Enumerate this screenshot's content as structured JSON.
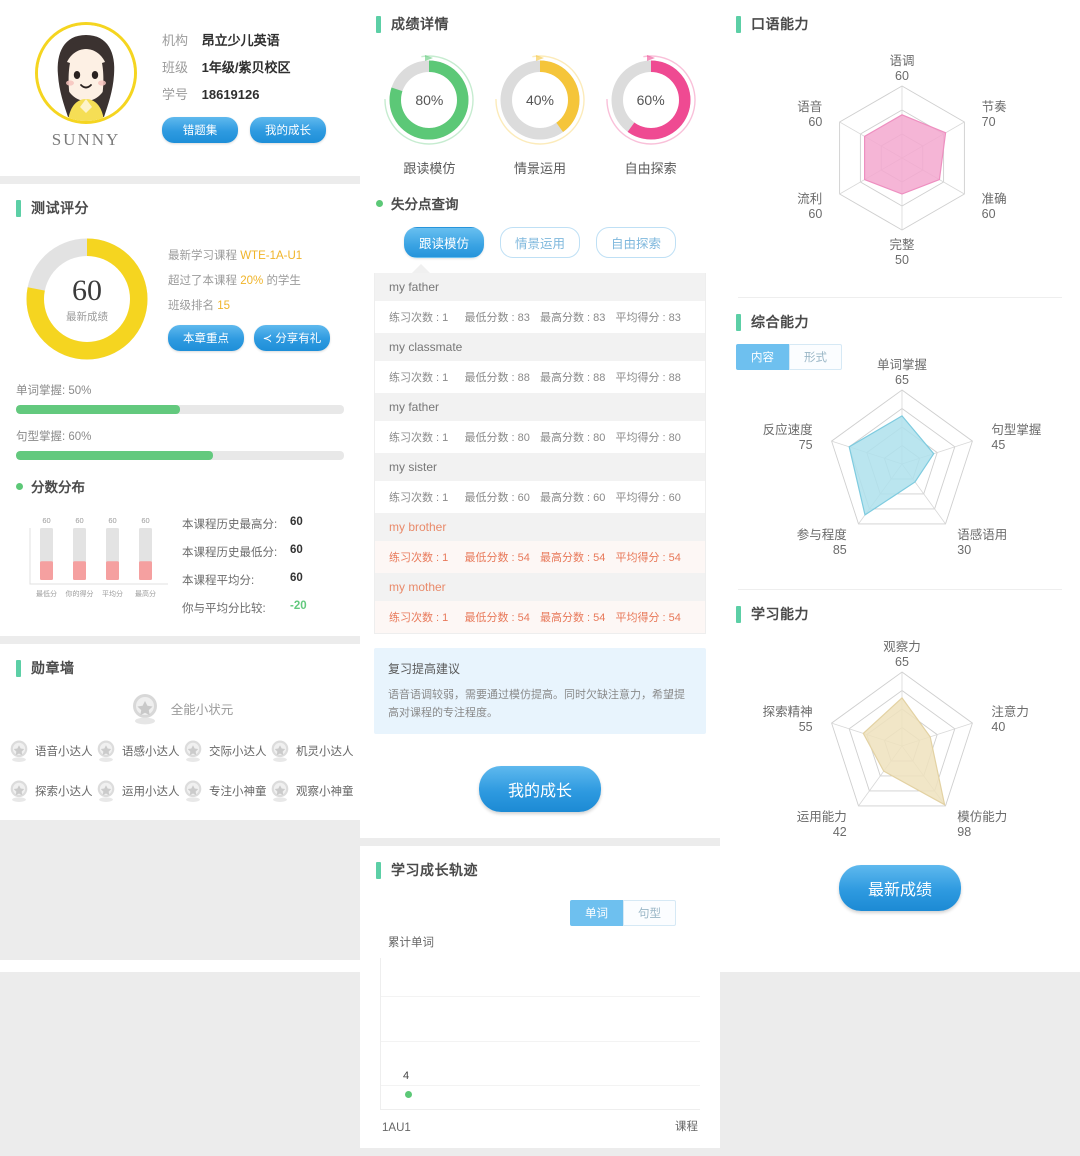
{
  "profile": {
    "name": "SUNNY",
    "fields": [
      {
        "key": "机构",
        "value": "昂立少儿英语"
      },
      {
        "key": "班级",
        "value": "1年级/紫贝校区"
      },
      {
        "key": "学号",
        "value": "18619126"
      }
    ],
    "buttons": [
      {
        "label": "错题集"
      },
      {
        "label": "我的成长"
      }
    ]
  },
  "test_score": {
    "title": "测试评分",
    "score": "60",
    "score_caption": "最新成绩",
    "ring_percent": 78,
    "ring_color": "#f5d520",
    "ring_track": "#e2e2e2",
    "info": {
      "course_label": "最新学习课程",
      "course_value": "WTE-1A-U1",
      "beat_prefix": "超过了本课程",
      "beat_value": "20%",
      "beat_suffix": "的学生",
      "rank_label": "班级排名",
      "rank_value": "15"
    },
    "buttons": [
      {
        "label": "本章重点"
      },
      {
        "label": "分享有礼"
      }
    ],
    "progress": [
      {
        "label": "单词掌握: 50%",
        "percent": 50
      },
      {
        "label": "句型掌握: 60%",
        "percent": 60
      }
    ]
  },
  "distribution": {
    "title": "分数分布",
    "chart_data": {
      "type": "bar",
      "title": "分数分布",
      "categories": [
        "最低分",
        "你的得分",
        "平均分",
        "最高分"
      ],
      "values": [
        60,
        60,
        60,
        60
      ],
      "value_labels": [
        "60",
        "60",
        "60",
        "60"
      ],
      "ylim": [
        0,
        170
      ],
      "bar_color": "#f5a0a0",
      "track_color": "#e3e3e3",
      "xlabel": "",
      "ylabel": "",
      "grid": false,
      "legend": "none"
    },
    "stats": [
      {
        "label": "本课程历史最高分:",
        "value": "60",
        "negative": false
      },
      {
        "label": "本课程历史最低分:",
        "value": "60",
        "negative": false
      },
      {
        "label": "本课程平均分:",
        "value": "60",
        "negative": false
      },
      {
        "label": "你与平均分比较:",
        "value": "-20",
        "negative": true
      }
    ]
  },
  "medals": {
    "title": "勋章墙",
    "top": {
      "label": "全能小状元"
    },
    "items": [
      {
        "label": "语音小达人"
      },
      {
        "label": "语感小达人"
      },
      {
        "label": "交际小达人"
      },
      {
        "label": "机灵小达人"
      },
      {
        "label": "探索小达人"
      },
      {
        "label": "运用小达人"
      },
      {
        "label": "专注小神童"
      },
      {
        "label": "观察小神童"
      }
    ]
  },
  "score_detail": {
    "title": "成绩详情",
    "chart_data": {
      "type": "pie",
      "title": "成绩详情",
      "categories": [
        "跟读模仿",
        "情景运用",
        "自由探索"
      ],
      "values": [
        80,
        40,
        60
      ],
      "value_labels": [
        "80%",
        "40%",
        "60%"
      ],
      "colors": [
        "#5cc877",
        "#f5c53a",
        "#ef4a92"
      ],
      "track_color": "#dcdcdc",
      "ylim": [
        0,
        100
      ],
      "legend": "bottom"
    }
  },
  "lost_points": {
    "title": "失分点查询",
    "tabs": [
      {
        "label": "跟读模仿",
        "active": true
      },
      {
        "label": "情景运用",
        "active": false
      },
      {
        "label": "自由探索",
        "active": false
      }
    ],
    "column_keys": [
      "练习次数",
      "最低分数",
      "最高分数",
      "平均得分"
    ],
    "rows": [
      {
        "name": "my father",
        "warn": false,
        "values": [
          "1",
          "83",
          "83",
          "83"
        ]
      },
      {
        "name": "my classmate",
        "warn": false,
        "values": [
          "1",
          "88",
          "88",
          "88"
        ]
      },
      {
        "name": "my father",
        "warn": false,
        "values": [
          "1",
          "80",
          "80",
          "80"
        ]
      },
      {
        "name": "my sister",
        "warn": false,
        "values": [
          "1",
          "60",
          "60",
          "60"
        ]
      },
      {
        "name": "my brother",
        "warn": true,
        "values": [
          "1",
          "54",
          "54",
          "54"
        ]
      },
      {
        "name": "my mother",
        "warn": true,
        "values": [
          "1",
          "54",
          "54",
          "54"
        ]
      }
    ]
  },
  "advice": {
    "title": "复习提高建议",
    "body": "语音语调较弱，需要通过模仿提高。同时欠缺注意力，希望提高对课程的专注程度。"
  },
  "growth_button": {
    "label": "我的成长"
  },
  "trajectory": {
    "title": "学习成长轨迹",
    "tabs": [
      {
        "label": "单词",
        "active": true
      },
      {
        "label": "句型",
        "active": false
      }
    ],
    "chart_data": {
      "type": "line",
      "title": "学习成长轨迹",
      "ylabel": "累计单词",
      "xlabel": "课程",
      "x": [
        "1AU1"
      ],
      "values": [
        4
      ],
      "point_labels": [
        "4"
      ],
      "point_color": "#5cc877",
      "ylim": [
        0,
        30
      ],
      "grid": true
    }
  },
  "oral": {
    "title": "口语能力",
    "chart_data": {
      "type": "radar",
      "title": "口语能力",
      "categories": [
        "语调",
        "节奏",
        "准确",
        "完整",
        "流利",
        "语音"
      ],
      "values": [
        60,
        70,
        60,
        50,
        60,
        60
      ],
      "max": 100,
      "rings": 3,
      "fill_color": "#f3a8cf",
      "line_color": "#ee8fc0"
    }
  },
  "comprehensive": {
    "title": "综合能力",
    "tabs": [
      {
        "label": "内容",
        "active": true
      },
      {
        "label": "形式",
        "active": false
      }
    ],
    "chart_data": {
      "type": "radar",
      "title": "综合能力",
      "categories": [
        "单词掌握",
        "句型掌握",
        "语感语用",
        "参与程度",
        "反应速度"
      ],
      "values": [
        65,
        45,
        30,
        85,
        75
      ],
      "max": 100,
      "rings": 4,
      "fill_color": "#aee0ec",
      "line_color": "#7ecbdf"
    }
  },
  "learning": {
    "title": "学习能力",
    "chart_data": {
      "type": "radar",
      "title": "学习能力",
      "categories": [
        "观察力",
        "注意力",
        "模仿能力",
        "运用能力",
        "探索精神"
      ],
      "values": [
        65,
        40,
        98,
        42,
        55
      ],
      "max": 100,
      "rings": 4,
      "fill_color": "#efe2bd",
      "line_color": "#e3d2a3"
    }
  },
  "latest_button": {
    "label": "最新成绩"
  }
}
